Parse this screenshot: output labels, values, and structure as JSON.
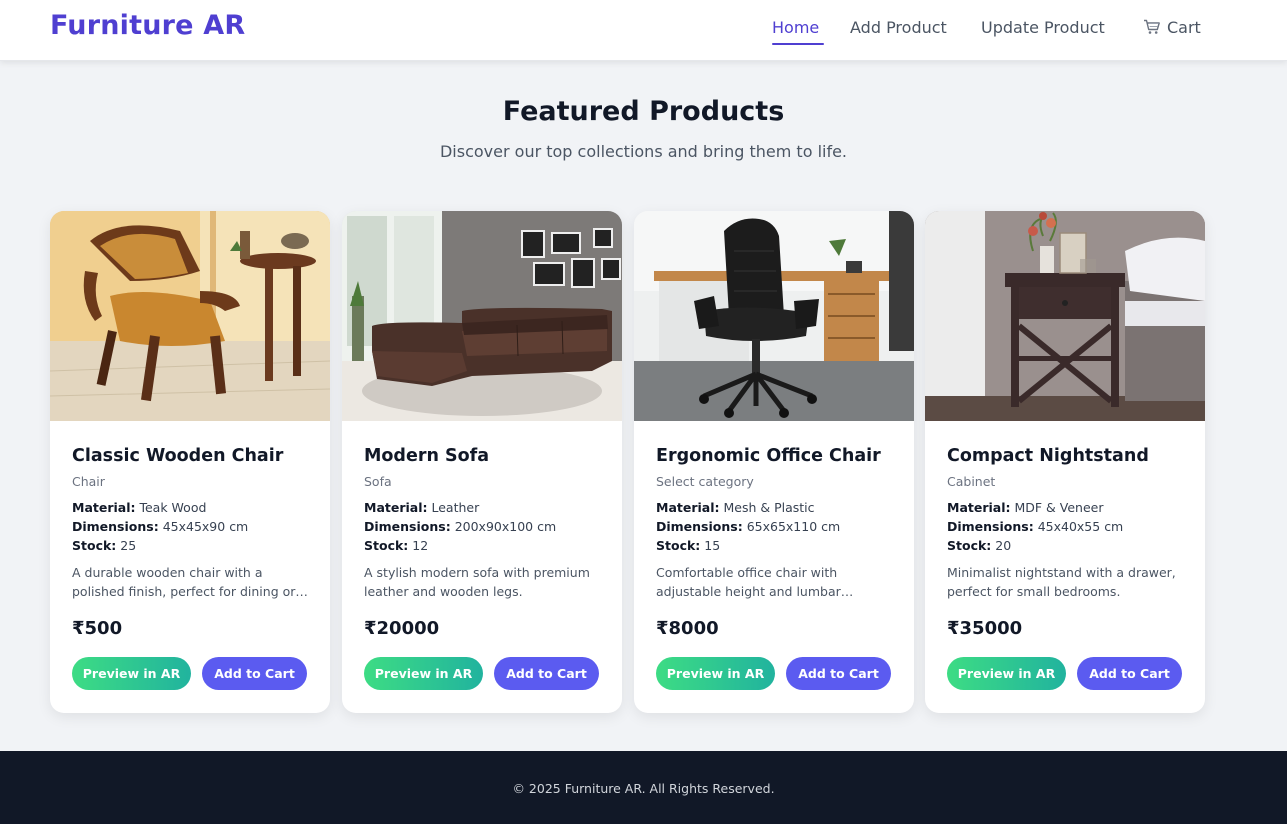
{
  "brand": "Furniture AR",
  "nav": {
    "home": "Home",
    "add_product": "Add Product",
    "update_product": "Update Product",
    "cart": "Cart",
    "active": "Home"
  },
  "hero": {
    "title": "Featured Products",
    "subtitle": "Discover our top collections and bring them to life."
  },
  "labels": {
    "material": "Material:",
    "dimensions": "Dimensions:",
    "stock": "Stock:",
    "preview_ar": "Preview in AR",
    "add_to_cart": "Add to Cart"
  },
  "products": [
    {
      "name": "Classic Wooden Chair",
      "category": "Chair",
      "material": "Teak Wood",
      "dimensions": "45x45x90 cm",
      "stock": "25",
      "description": "A durable wooden chair with a polished finish, perfect for dining or study rooms.",
      "price": "₹500",
      "image_icon": "wooden-armchair-photo"
    },
    {
      "name": "Modern Sofa",
      "category": "Sofa",
      "material": "Leather",
      "dimensions": "200x90x100 cm",
      "stock": "12",
      "description": "A stylish modern sofa with premium leather and wooden legs.",
      "price": "₹20000",
      "image_icon": "sectional-sofa-photo"
    },
    {
      "name": "Ergonomic Office Chair",
      "category": "Select category",
      "material": "Mesh & Plastic",
      "dimensions": "65x65x110 cm",
      "stock": "15",
      "description": "Comfortable office chair with adjustable height and lumbar support.",
      "price": "₹8000",
      "image_icon": "office-chair-photo"
    },
    {
      "name": "Compact Nightstand",
      "category": "Cabinet",
      "material": "MDF & Veneer",
      "dimensions": "45x40x55 cm",
      "stock": "20",
      "description": "Minimalist nightstand with a drawer, perfect for small bedrooms.",
      "price": "₹35000",
      "image_icon": "nightstand-photo"
    }
  ],
  "footer": "© 2025 Furniture AR. All Rights Reserved.",
  "colors": {
    "brand": "#4f3fd1",
    "page_bg": "#f1f3f6",
    "footer_bg": "#111827",
    "ar_button_start": "#3ddc84",
    "ar_button_end": "#21b39e",
    "cart_button": "#5b5bf0"
  }
}
